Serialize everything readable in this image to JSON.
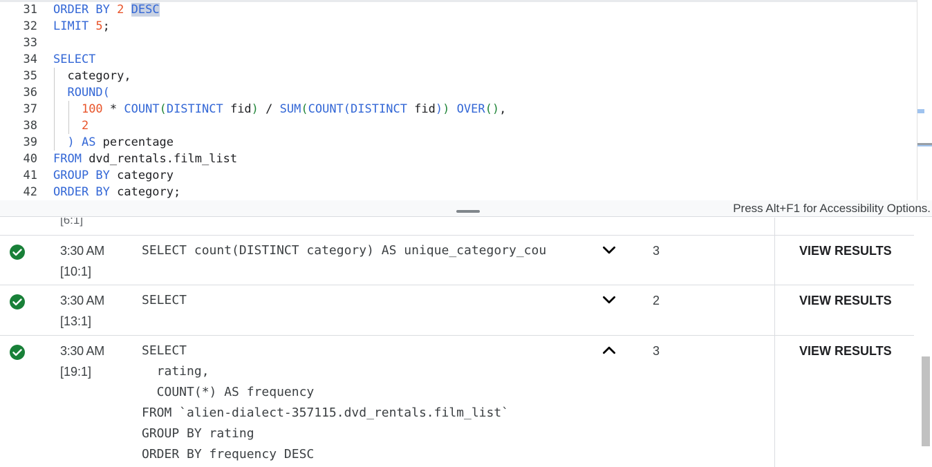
{
  "editor": {
    "lines": [
      {
        "no": "31",
        "tokens": [
          {
            "t": "ORDER BY ",
            "c": "kw"
          },
          {
            "t": "2",
            "c": "num"
          },
          {
            "t": " ",
            "c": "id"
          },
          {
            "t": "DESC",
            "c": "kw hl"
          }
        ]
      },
      {
        "no": "32",
        "tokens": [
          {
            "t": "LIMIT ",
            "c": "kw"
          },
          {
            "t": "5",
            "c": "num"
          },
          {
            "t": ";",
            "c": "punc"
          }
        ]
      },
      {
        "no": "33",
        "tokens": []
      },
      {
        "no": "34",
        "tokens": [
          {
            "t": "SELECT",
            "c": "kw"
          }
        ]
      },
      {
        "no": "35",
        "tokens": [
          {
            "t": "  category,",
            "c": "id"
          }
        ]
      },
      {
        "no": "36",
        "tokens": [
          {
            "t": "  ROUND(",
            "c": "kw"
          }
        ]
      },
      {
        "no": "37",
        "tokens": [
          {
            "t": "    ",
            "c": "id"
          },
          {
            "t": "100",
            "c": "num"
          },
          {
            "t": " * ",
            "c": "id"
          },
          {
            "t": "COUNT",
            "c": "kw"
          },
          {
            "t": "(",
            "c": "paren2"
          },
          {
            "t": "DISTINCT",
            "c": "kw"
          },
          {
            "t": " fid",
            "c": "id"
          },
          {
            "t": ")",
            "c": "paren2"
          },
          {
            "t": " / ",
            "c": "id"
          },
          {
            "t": "SUM",
            "c": "kw"
          },
          {
            "t": "(",
            "c": "paren2"
          },
          {
            "t": "COUNT",
            "c": "kw"
          },
          {
            "t": "(",
            "c": "paren1"
          },
          {
            "t": "DISTINCT",
            "c": "kw"
          },
          {
            "t": " fid",
            "c": "id"
          },
          {
            "t": ")",
            "c": "paren1"
          },
          {
            "t": ")",
            "c": "paren2"
          },
          {
            "t": " OVER",
            "c": "kw"
          },
          {
            "t": "()",
            "c": "paren2"
          },
          {
            "t": ",",
            "c": "id"
          }
        ]
      },
      {
        "no": "38",
        "tokens": [
          {
            "t": "    ",
            "c": "id"
          },
          {
            "t": "2",
            "c": "num"
          }
        ]
      },
      {
        "no": "39",
        "tokens": [
          {
            "t": "  )",
            "c": "kw"
          },
          {
            "t": " AS ",
            "c": "kw"
          },
          {
            "t": "percentage",
            "c": "id"
          }
        ]
      },
      {
        "no": "40",
        "tokens": [
          {
            "t": "FROM ",
            "c": "kw"
          },
          {
            "t": "dvd_rentals.film_list",
            "c": "id"
          }
        ]
      },
      {
        "no": "41",
        "tokens": [
          {
            "t": "GROUP BY ",
            "c": "kw"
          },
          {
            "t": "category",
            "c": "id"
          }
        ]
      },
      {
        "no": "42",
        "tokens": [
          {
            "t": "ORDER BY ",
            "c": "kw"
          },
          {
            "t": "category;",
            "c": "id"
          }
        ]
      }
    ]
  },
  "splitter": {
    "accessibility_hint": "Press Alt+F1 for Accessibility Options."
  },
  "history": {
    "partial_position": "[6:1]",
    "rows": [
      {
        "time": "3:30 AM",
        "position": "[10:1]",
        "query": "SELECT count(DISTINCT category) AS unique_category_cou",
        "expanded": false,
        "count": "3",
        "action": "VIEW RESULTS",
        "status_icon": "check-circle-icon"
      },
      {
        "time": "3:30 AM",
        "position": "[13:1]",
        "query": "SELECT",
        "expanded": false,
        "count": "2",
        "action": "VIEW RESULTS",
        "status_icon": "check-circle-icon"
      },
      {
        "time": "3:30 AM",
        "position": "[19:1]",
        "query": "SELECT\n  rating,\n  COUNT(*) AS frequency\nFROM `alien-dialect-357115.dvd_rentals.film_list`\nGROUP BY rating\nORDER BY frequency DESC",
        "expanded": true,
        "count": "3",
        "action": "VIEW RESULTS",
        "status_icon": "check-circle-icon"
      }
    ]
  },
  "colors": {
    "success": "#188038",
    "keyword": "#3367d6",
    "number": "#e8542a"
  }
}
